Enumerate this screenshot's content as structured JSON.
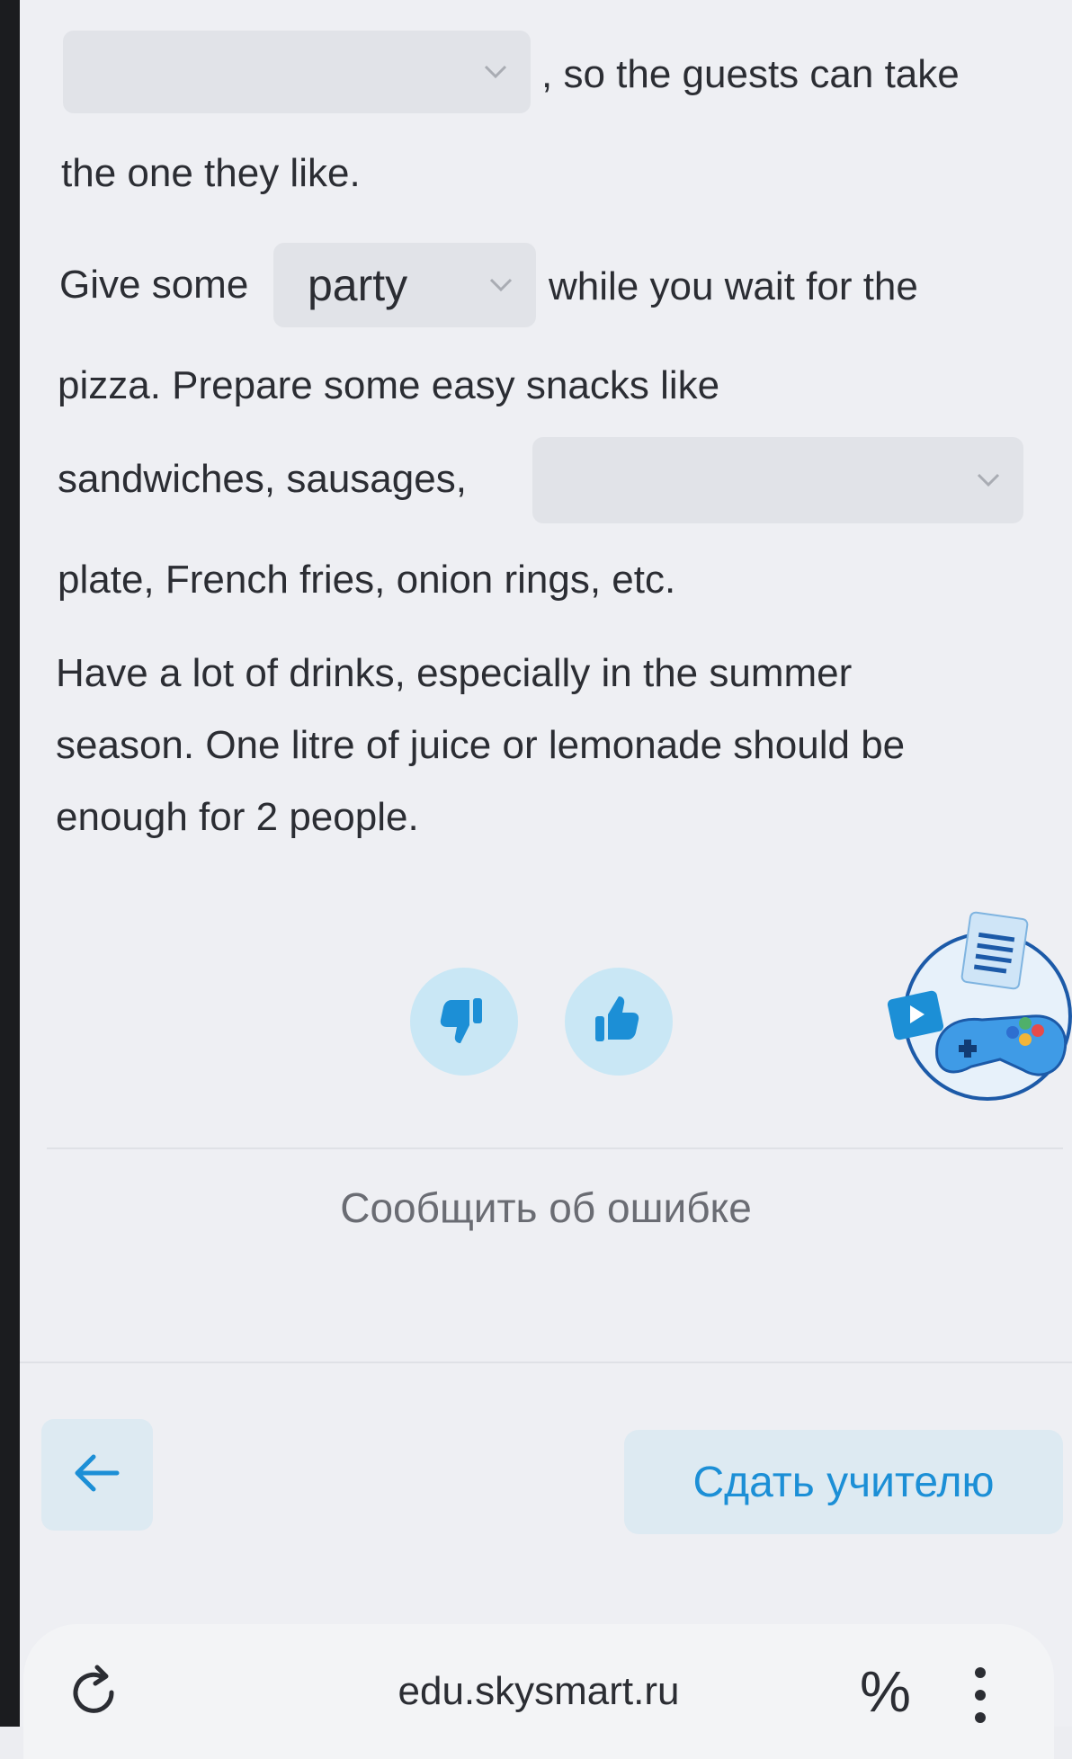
{
  "exercise": {
    "line1_after_blank": ", so the guests can take",
    "line2": "the one they like.",
    "line3_before": "Give some",
    "dropdown2_value": "party",
    "line3_after": "while you wait for the",
    "line4": "pizza. Prepare some easy snacks like",
    "line5_before": "sandwiches, sausages,",
    "line6": "plate, French fries, onion rings, etc.",
    "paragraph2": [
      "Have a lot of drinks, especially in the summer",
      "season. One litre of juice or lemonade should be",
      "enough for 2 people."
    ]
  },
  "feedback": {
    "dislike_icon": "thumbs-down-icon",
    "like_icon": "thumbs-up-icon",
    "report_label": "Сообщить об ошибке"
  },
  "nav": {
    "back_icon": "arrow-left-icon",
    "submit_label": "Сдать учителю"
  },
  "browser": {
    "url": "edu.skysmart.ru",
    "percent_label": "%"
  },
  "colors": {
    "accent": "#1c8fd6",
    "button_bg": "#c9e7f5"
  }
}
